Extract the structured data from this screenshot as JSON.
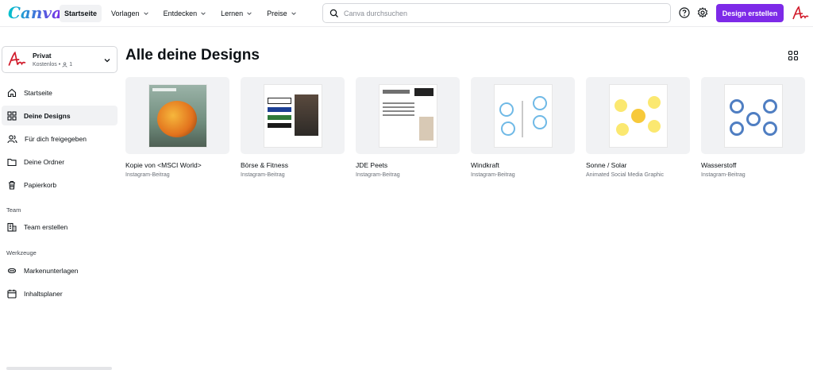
{
  "app": {
    "logo": "Canva"
  },
  "nav": [
    {
      "label": "Startseite",
      "active": true,
      "dropdown": false
    },
    {
      "label": "Vorlagen",
      "active": false,
      "dropdown": true
    },
    {
      "label": "Entdecken",
      "active": false,
      "dropdown": true
    },
    {
      "label": "Lernen",
      "active": false,
      "dropdown": true
    },
    {
      "label": "Preise",
      "active": false,
      "dropdown": true
    }
  ],
  "search": {
    "placeholder": "Canva durchsuchen",
    "icon": "search-icon"
  },
  "header_actions": {
    "help_icon": "help-icon",
    "settings_icon": "gear-icon",
    "create_label": "Design erstellen",
    "accent": "#7d2ae8"
  },
  "account": {
    "name": "Privat",
    "plan": "Kostenlos",
    "members": "1"
  },
  "sidebar": {
    "items": [
      {
        "label": "Startseite",
        "icon": "home-icon",
        "active": false
      },
      {
        "label": "Deine Designs",
        "icon": "designs-grid-icon",
        "active": true
      },
      {
        "label": "Für dich freigegeben",
        "icon": "shared-users-icon",
        "active": false
      },
      {
        "label": "Deine Ordner",
        "icon": "folder-icon",
        "active": false
      },
      {
        "label": "Papierkorb",
        "icon": "trash-icon",
        "active": false
      }
    ],
    "team_heading": "Team",
    "team_items": [
      {
        "label": "Team erstellen",
        "icon": "building-icon"
      }
    ],
    "tools_heading": "Werkzeuge",
    "tools_items": [
      {
        "label": "Markenunterlagen",
        "icon": "brand-kit-icon"
      },
      {
        "label": "Inhaltsplaner",
        "icon": "calendar-icon"
      }
    ]
  },
  "main": {
    "title": "Alle deine Designs",
    "view_toggle_icon": "grid-view-icon",
    "designs": [
      {
        "title": "Kopie von <MSCI World>",
        "type": "Instagram-Beitrag"
      },
      {
        "title": "Börse & Fitness",
        "type": "Instagram-Beitrag"
      },
      {
        "title": "JDE Peets",
        "type": "Instagram-Beitrag"
      },
      {
        "title": "Windkraft",
        "type": "Instagram-Beitrag"
      },
      {
        "title": "Sonne / Solar",
        "type": "Animated Social Media Graphic"
      },
      {
        "title": "Wasserstoff",
        "type": "Instagram-Beitrag"
      }
    ]
  }
}
